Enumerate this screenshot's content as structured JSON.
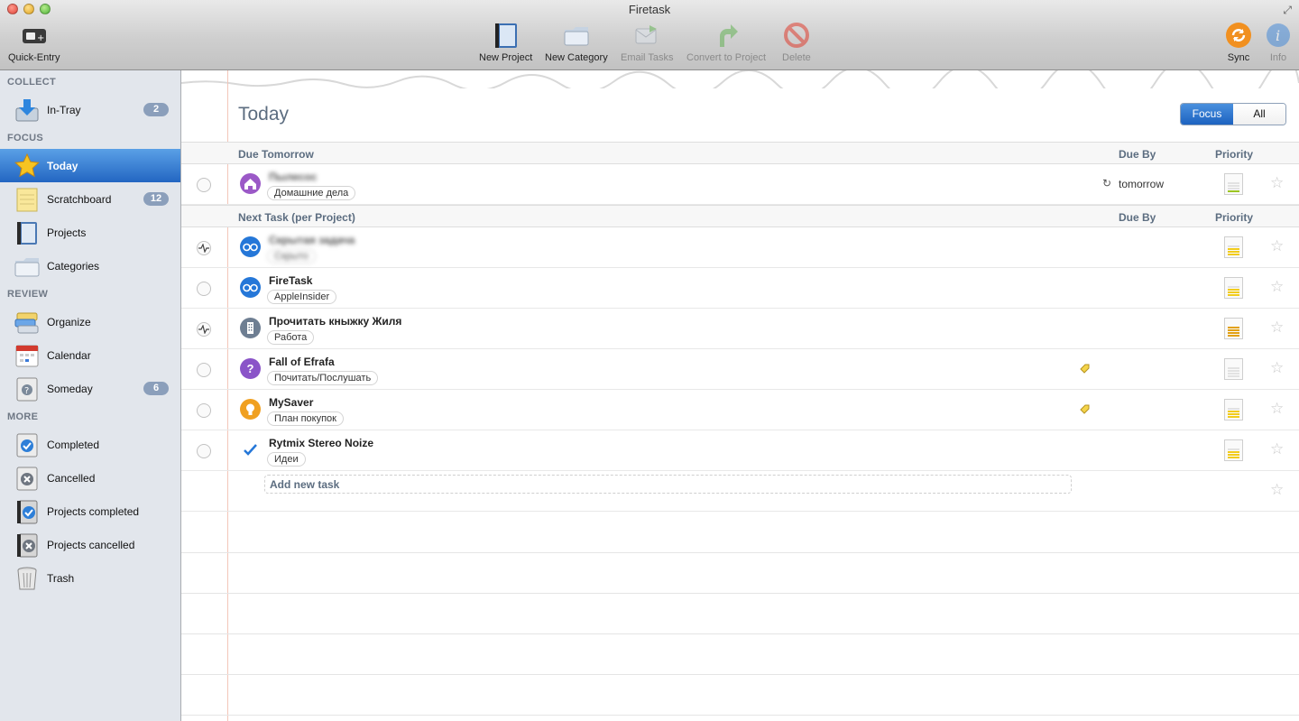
{
  "window": {
    "title": "Firetask"
  },
  "toolbar": {
    "quick_entry": "Quick-Entry",
    "new_project": "New Project",
    "new_category": "New Category",
    "email_tasks": "Email Tasks",
    "convert_to_project": "Convert to Project",
    "delete": "Delete",
    "sync": "Sync",
    "info": "Info"
  },
  "sidebar": {
    "collect_header": "COLLECT",
    "focus_header": "FOCUS",
    "review_header": "REVIEW",
    "more_header": "MORE",
    "items": [
      {
        "label": "In-Tray",
        "badge": "2",
        "icon": "inbox-tray-icon"
      },
      {
        "label": "Today",
        "icon": "star-icon",
        "selected": true
      },
      {
        "label": "Scratchboard",
        "badge": "12",
        "icon": "notepad-icon"
      },
      {
        "label": "Projects",
        "icon": "notebook-icon"
      },
      {
        "label": "Categories",
        "icon": "folder-icon"
      },
      {
        "label": "Organize",
        "icon": "organize-icon"
      },
      {
        "label": "Calendar",
        "icon": "calendar-icon"
      },
      {
        "label": "Someday",
        "badge": "6",
        "icon": "someday-icon"
      },
      {
        "label": "Completed",
        "icon": "completed-icon"
      },
      {
        "label": "Cancelled",
        "icon": "cancelled-icon"
      },
      {
        "label": "Projects completed",
        "icon": "projects-completed-icon"
      },
      {
        "label": "Projects cancelled",
        "icon": "projects-cancelled-icon"
      },
      {
        "label": "Trash",
        "icon": "trash-icon"
      }
    ]
  },
  "main": {
    "title": "Today",
    "view_toggle": {
      "focus": "Focus",
      "all": "All",
      "selected": "Focus"
    },
    "due_tomorrow": {
      "title": "Due Tomorrow",
      "due_by": "Due By",
      "priority": "Priority",
      "tasks": [
        {
          "name": "Пылесос",
          "tag": "Домашние дела",
          "due": "tomorrow",
          "icon": "home-icon",
          "color": "#9b59c7",
          "priority_bars": 1,
          "priority_color": "#9cc522"
        }
      ]
    },
    "next_task": {
      "title": "Next Task (per Project)",
      "due_by": "Due By",
      "priority": "Priority",
      "tasks": [
        {
          "name": "Скрытая задача",
          "tag": "Скрыто",
          "icon": "glasses-icon",
          "color": "#2577d8",
          "check": "pulse",
          "priority_bars": 3,
          "priority_color": "#f2cc1c"
        },
        {
          "name": "FireTask",
          "tag": "AppleInsider",
          "icon": "glasses-icon",
          "color": "#2577d8",
          "check": "empty",
          "priority_bars": 3,
          "priority_color": "#f2cc1c"
        },
        {
          "name": "Прочитать кныжку Жиля",
          "tag": "Работа",
          "icon": "building-icon",
          "color": "#6e7e92",
          "check": "pulse",
          "priority_bars": 4,
          "priority_color": "#e2a112"
        },
        {
          "name": "Fall of Efrafa",
          "tag": "Почитать/Послушать",
          "icon": "question-icon",
          "color": "#8a54c8",
          "check": "empty",
          "has_note": true,
          "priority_bars": 0,
          "priority_color": "#e2e2e2"
        },
        {
          "name": "MySaver",
          "tag": "План покупок",
          "icon": "lightbulb-icon",
          "color": "#f0a020",
          "check": "empty",
          "has_note": true,
          "priority_bars": 3,
          "priority_color": "#f2cc1c"
        },
        {
          "name": "Rytmix Stereo Noize",
          "tag": "Идеи",
          "icon": "checkmark-icon",
          "color": "#ffffff",
          "check": "empty",
          "priority_bars": 3,
          "priority_color": "#f2cc1c"
        }
      ]
    },
    "add_task": "Add new task",
    "blurred_first_name": "Пылесос",
    "due_icon": "repeat-icon"
  }
}
